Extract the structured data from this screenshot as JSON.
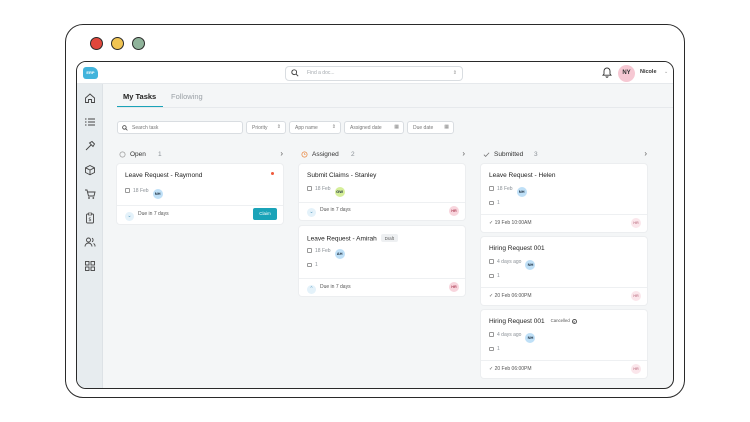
{
  "app": {
    "logo_text": "ERP"
  },
  "search": {
    "placeholder": "Find a doc..."
  },
  "user": {
    "initials": "NY",
    "name": "Nicole"
  },
  "tabs": {
    "active": "My Tasks",
    "other": "Following"
  },
  "filters": {
    "search_placeholder": "Search task",
    "priority": "Priority",
    "app_name": "App name",
    "assigned_date": "Assigned date",
    "due_date": "Due date"
  },
  "columns": [
    {
      "title": "Open",
      "count": "1",
      "cards": [
        {
          "title": "Leave Request - Raymond",
          "date": "18 Feb",
          "assignee": "NH",
          "due": "Due in 7 days",
          "action": "Claim"
        }
      ]
    },
    {
      "title": "Assigned",
      "count": "2",
      "cards": [
        {
          "title": "Submit Claims - Stanley",
          "date": "18 Feb",
          "assignee": "GW",
          "due": "Due in 7 days",
          "owner": "HR"
        },
        {
          "title": "Leave Request - Amirah",
          "badge": "Draft",
          "date": "18 Feb",
          "assignee": "AH",
          "comments": "1",
          "due": "Due in 7 days",
          "owner": "HR"
        }
      ]
    },
    {
      "title": "Submitted",
      "count": "3",
      "cards": [
        {
          "title": "Leave Request - Helen",
          "date": "18 Feb",
          "assignee": "NH",
          "comments": "1",
          "submitted": "19 Feb  10:00AM",
          "owner": "HR"
        },
        {
          "title": "Hiring Request 001",
          "date": "4 days ago",
          "assignee": "NH",
          "comments": "1",
          "submitted": "20 Feb  06:00PM",
          "owner": "HR"
        },
        {
          "title": "Hiring Request 001",
          "badge": "Cancelled",
          "date": "4 days ago",
          "assignee": "NH",
          "comments": "1",
          "submitted": "20 Feb  06:00PM",
          "owner": "HR"
        }
      ]
    }
  ],
  "colors": {
    "accent": "#1aa3b8",
    "logo": "#42b4dc",
    "avatar_pink": "#f6c8d3"
  }
}
